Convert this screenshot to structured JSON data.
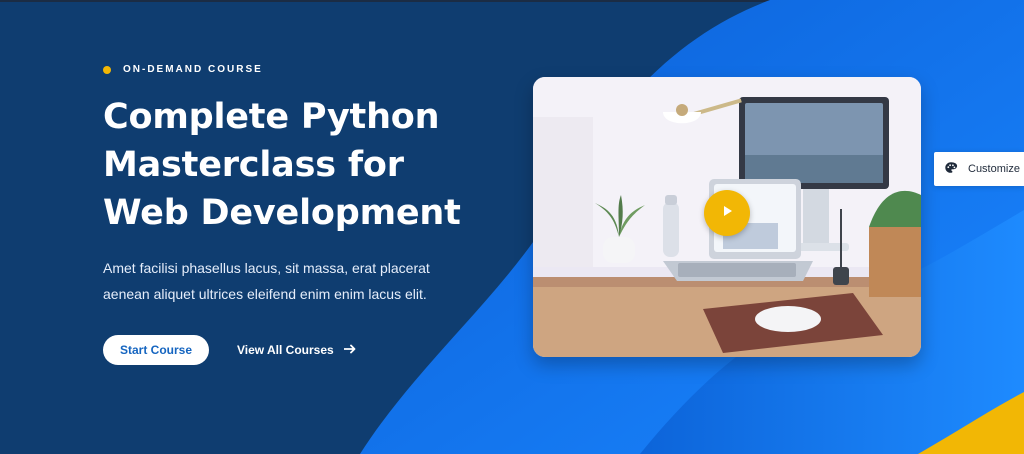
{
  "hero": {
    "eyebrow": "ON-DEMAND COURSE",
    "title_line_1": "Complete Python",
    "title_line_2": "Masterclass for",
    "title_line_3": "Web Development",
    "description": "Amet facilisi phasellus lacus, sit massa, erat placerat aenean aliquet ultrices eleifend enim enim lacus elit."
  },
  "actions": {
    "primary_label": "Start Course",
    "secondary_label": "View All Courses"
  },
  "customize": {
    "label": "Customize"
  },
  "colors": {
    "navy": "#0f3d70",
    "blue": "#0b6fe6",
    "accent": "#f2b705"
  },
  "icons": [
    "play-icon",
    "arrow-right-icon",
    "palette-icon"
  ]
}
